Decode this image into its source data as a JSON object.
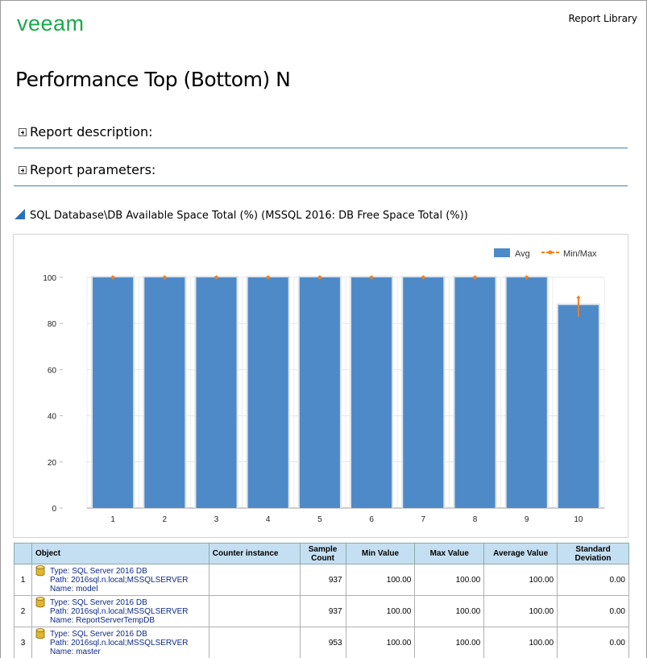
{
  "header": {
    "logo_text": "veeam",
    "library_link": "Report Library"
  },
  "page_title": "Performance Top (Bottom) N",
  "sections": [
    {
      "label": "Report description:"
    },
    {
      "label": "Report parameters:"
    }
  ],
  "chart_heading": "SQL Database\\DB Available Space Total (%) (MSSQL 2016: DB Free Space Total (%))",
  "legend": {
    "avg": "Avg",
    "minmax": "Min/Max"
  },
  "colors": {
    "bar": "#4e8ac8",
    "minmax": "#f07f1f",
    "brand": "#1aaa4b",
    "header_bg": "#c5dff2"
  },
  "chart_data": {
    "type": "bar",
    "categories": [
      "1",
      "2",
      "3",
      "4",
      "5",
      "6",
      "7",
      "8",
      "9",
      "10"
    ],
    "series": [
      {
        "name": "Avg",
        "values": [
          100,
          100,
          100,
          100,
          100,
          100,
          100,
          100,
          100,
          88
        ]
      }
    ],
    "min": [
      100,
      100,
      100,
      100,
      100,
      100,
      100,
      100,
      100,
      83
    ],
    "max": [
      100,
      100,
      100,
      100,
      100,
      100,
      100,
      100,
      100,
      92
    ],
    "yticks": [
      "0",
      "20",
      "40",
      "60",
      "80",
      "100"
    ],
    "ylim": [
      0,
      100
    ],
    "grid": true,
    "legend_position": "top-right"
  },
  "table": {
    "columns": [
      "Object",
      "Counter instance",
      "Sample Count",
      "Min Value",
      "Max Value",
      "Average Value",
      "Standard Deviation"
    ],
    "rows": [
      {
        "idx": "1",
        "type": "Type: SQL Server 2016 DB",
        "path": "Path: 2016sql.n.local;MSSQLSERVER",
        "name": "Name: model",
        "instance": "",
        "samples": "937",
        "min": "100.00",
        "max": "100.00",
        "avg": "100.00",
        "std": "0.00"
      },
      {
        "idx": "2",
        "type": "Type: SQL Server 2016 DB",
        "path": "Path: 2016sql.n.local;MSSQLSERVER",
        "name": "Name: ReportServerTempDB",
        "instance": "",
        "samples": "937",
        "min": "100.00",
        "max": "100.00",
        "avg": "100.00",
        "std": "0.00"
      },
      {
        "idx": "3",
        "type": "Type: SQL Server 2016 DB",
        "path": "Path: 2016sql.n.local;MSSQLSERVER",
        "name": "Name: master",
        "instance": "",
        "samples": "953",
        "min": "100.00",
        "max": "100.00",
        "avg": "100.00",
        "std": "0.00"
      }
    ]
  }
}
